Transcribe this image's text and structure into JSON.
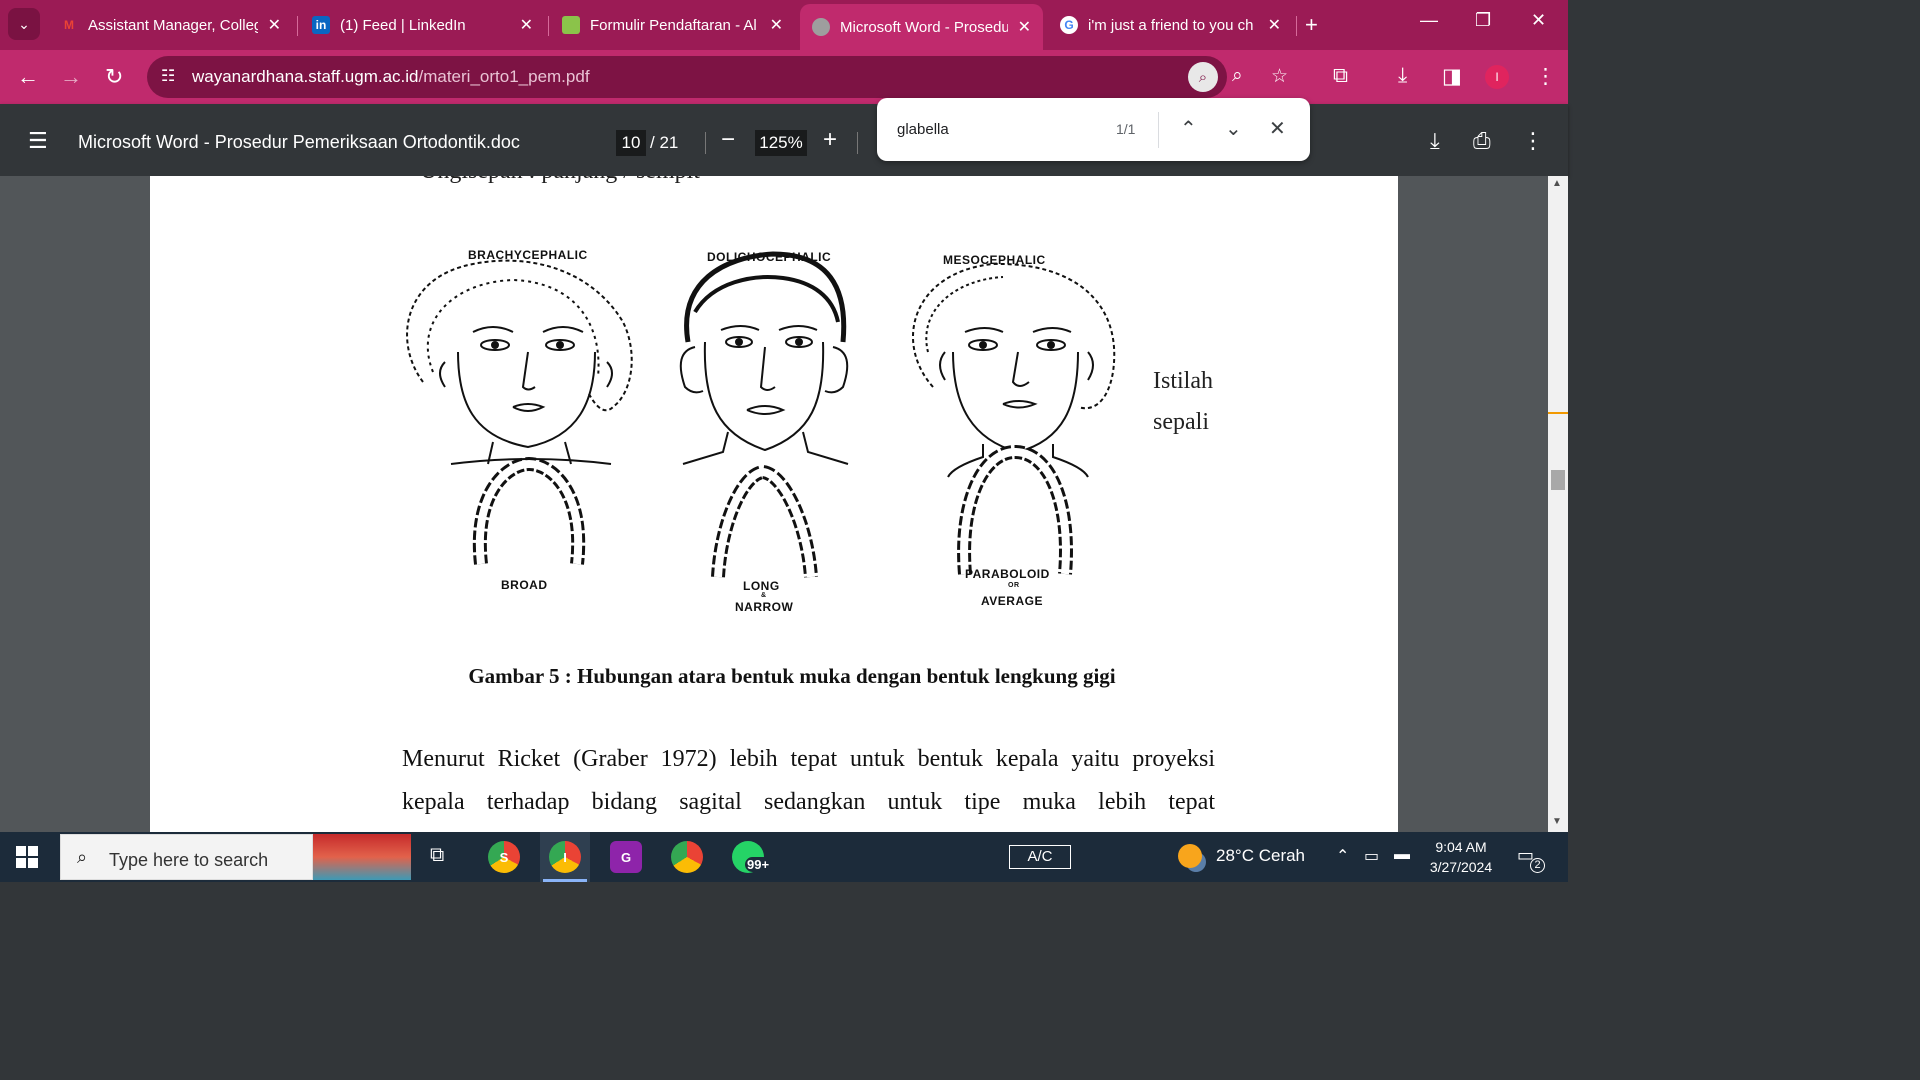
{
  "tabs": [
    {
      "title": "Assistant Manager, College",
      "icon": "gmail-icon",
      "icon_text": "M"
    },
    {
      "title": "(1) Feed | LinkedIn",
      "icon": "linkedin-icon",
      "icon_text": "in"
    },
    {
      "title": "Formulir Pendaftaran - Al",
      "icon": "forms-icon",
      "icon_text": ""
    },
    {
      "title": "Microsoft Word - Prosedur",
      "icon": "globe-icon",
      "icon_text": ""
    },
    {
      "title": "i'm just a friend to you ch",
      "icon": "google-icon",
      "icon_text": "G"
    }
  ],
  "address": {
    "domain": "wayanardhana.staff.ugm.ac.id",
    "path": "/materi_orto1_pem.pdf"
  },
  "profile_initial": "I",
  "pdf": {
    "title": "Microsoft Word - Prosedur Pemeriksaan Ortodontik.doc",
    "current_page": "10",
    "total_pages": "/ 21",
    "zoom": "125%"
  },
  "find": {
    "query": "glabella",
    "count": "1/1"
  },
  "document": {
    "cut_line": "Ungisepan  :  panjang / sempit",
    "figure_labels": {
      "brachy": "BRACHYCEPHALIC",
      "dolicho": "DOLICHOCEPHALIC",
      "meso": "MESOCEPHALIC",
      "broad": "BROAD",
      "long": "LONG",
      "amp": "&",
      "narrow": "NARROW",
      "paraboloid": "PARABOLOID",
      "or": "OR",
      "average": "AVERAGE"
    },
    "side_line1": "Istilah",
    "side_line2": "sepali",
    "caption": "Gambar 5 : Hubungan atara bentuk muka dengan bentuk lengkung gigi",
    "para_line1": "Menurut Ricket (Graber 1972) lebih tepat untuk bentuk kepala yaitu proyeksi",
    "para_line2_words": [
      "kepala",
      "terhadap",
      "bidang",
      "sagital",
      "sedangkan",
      "untuk",
      "tipe",
      "muka",
      "lebih",
      "tepat"
    ]
  },
  "taskbar": {
    "search_placeholder": "Type here to search",
    "whatsapp_badge": "99+",
    "ac_label": "A/C",
    "weather": "28°C  Cerah",
    "time": "9:04 AM",
    "date": "3/27/2024",
    "notifications": "2"
  },
  "colors": {
    "accent": "#c02a6d",
    "tabstrip": "#9b1b55",
    "pdf_toolbar": "#323639"
  }
}
